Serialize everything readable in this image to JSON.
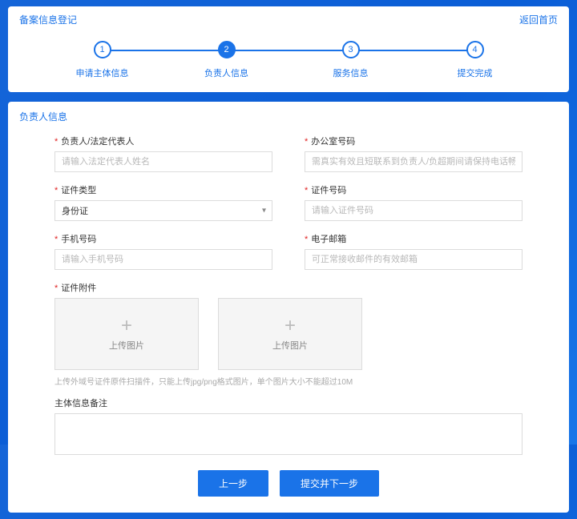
{
  "header": {
    "title": "备案信息登记",
    "back": "返回首页"
  },
  "stepper": {
    "steps": [
      {
        "num": "1",
        "label": "申请主体信息"
      },
      {
        "num": "2",
        "label": "负责人信息"
      },
      {
        "num": "3",
        "label": "服务信息"
      },
      {
        "num": "4",
        "label": "提交完成"
      }
    ],
    "activeIndex": 1
  },
  "section_title": "负责人信息",
  "fields": {
    "name": {
      "label": "负责人/法定代表人",
      "placeholder": "请输入法定代表人姓名",
      "required": true
    },
    "office_phone": {
      "label": "办公室号码",
      "placeholder": "需真实有效且短联系到负责人/负超期间请保持电话畅通以便顺利核实！",
      "required": true
    },
    "doc_type": {
      "label": "证件类型",
      "value": "身份证",
      "required": true
    },
    "doc_no": {
      "label": "证件号码",
      "placeholder": "请输入证件号码",
      "required": true
    },
    "mobile": {
      "label": "手机号码",
      "placeholder": "请输入手机号码",
      "required": true
    },
    "email": {
      "label": "电子邮箱",
      "placeholder": "可正常接收邮件的有效邮箱",
      "required": true
    },
    "doc_attach": {
      "label": "证件附件",
      "required": true
    },
    "remark": {
      "label": "主体信息备注",
      "required": false
    }
  },
  "upload": {
    "plus": "+",
    "text": "上传图片",
    "hint": "上传外域号证件原件扫描件，只能上传jpg/png格式图片，单个图片大小不能超过10M"
  },
  "buttons": {
    "prev": "上一步",
    "next": "提交并下一步"
  }
}
